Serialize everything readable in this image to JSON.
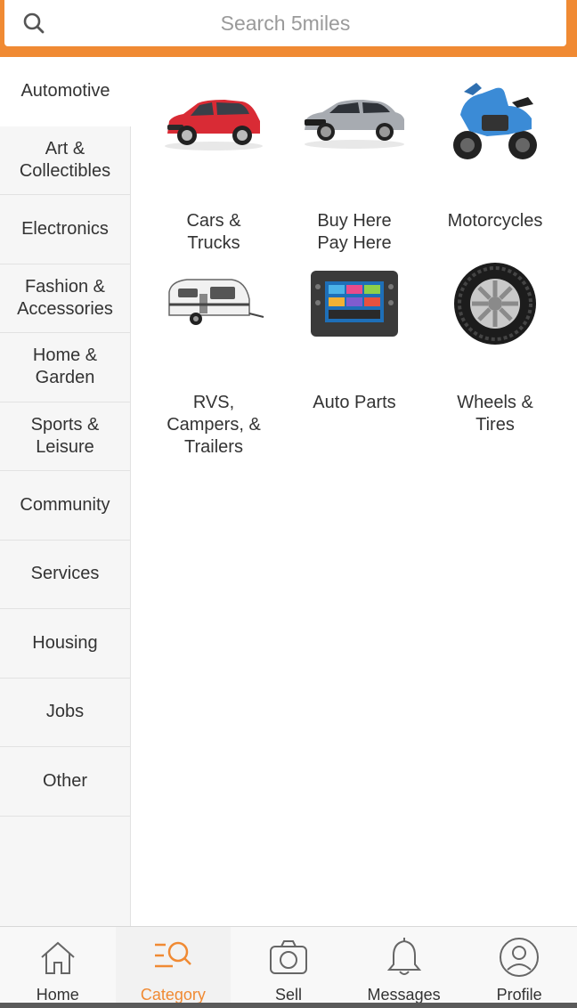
{
  "search": {
    "placeholder": "Search 5miles"
  },
  "sidebar": {
    "items": [
      {
        "label": "Automotive",
        "active": true
      },
      {
        "label": "Art &\nCollectibles"
      },
      {
        "label": "Electronics"
      },
      {
        "label": "Fashion &\nAccessories"
      },
      {
        "label": "Home &\nGarden"
      },
      {
        "label": "Sports &\nLeisure"
      },
      {
        "label": "Community"
      },
      {
        "label": "Services"
      },
      {
        "label": "Housing"
      },
      {
        "label": "Jobs"
      },
      {
        "label": "Other"
      }
    ]
  },
  "categories": [
    {
      "label": "Cars &\nTrucks",
      "icon": "red-suv-icon"
    },
    {
      "label": "Buy Here\nPay Here",
      "icon": "silver-sedan-icon"
    },
    {
      "label": "Motorcycles",
      "icon": "blue-motorcycle-icon"
    },
    {
      "label": "RVS,\nCampers, &\nTrailers",
      "icon": "camper-trailer-icon"
    },
    {
      "label": "Auto Parts",
      "icon": "car-stereo-icon"
    },
    {
      "label": "Wheels &\nTires",
      "icon": "tire-icon"
    }
  ],
  "tabbar": {
    "tabs": [
      {
        "label": "Home",
        "icon": "home-icon"
      },
      {
        "label": "Category",
        "icon": "category-search-icon",
        "active": true
      },
      {
        "label": "Sell",
        "icon": "camera-icon"
      },
      {
        "label": "Messages",
        "icon": "bell-icon"
      },
      {
        "label": "Profile",
        "icon": "profile-icon"
      }
    ]
  },
  "colors": {
    "accent": "#f08a33",
    "text": "#333333",
    "sidebar_bg": "#f6f6f6"
  }
}
